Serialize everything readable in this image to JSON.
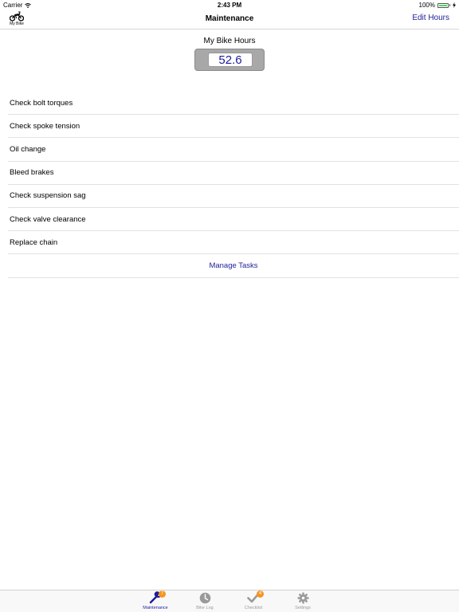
{
  "status_bar": {
    "carrier": "Carrier",
    "time": "2:43 PM",
    "battery": "100%",
    "battery_level": 1.0
  },
  "nav": {
    "left_label": "My Bike",
    "left_icon": "motorbike-icon",
    "title": "Maintenance",
    "right_button": "Edit Hours"
  },
  "hours": {
    "label": "My Bike Hours",
    "value": "52.6"
  },
  "tasks": [
    {
      "label": "Check bolt torques"
    },
    {
      "label": "Check spoke tension"
    },
    {
      "label": "Oil change"
    },
    {
      "label": "Bleed brakes"
    },
    {
      "label": "Check suspension sag"
    },
    {
      "label": "Check valve clearance"
    },
    {
      "label": "Replace chain"
    }
  ],
  "manage_tasks": "Manage Tasks",
  "tab_bar": {
    "tabs": [
      {
        "label": "Maintenance",
        "icon": "wrench-icon",
        "badge": "7",
        "active": true
      },
      {
        "label": "Bike Log",
        "icon": "clock-icon",
        "badge": "",
        "active": false
      },
      {
        "label": "Checklist",
        "icon": "checkmark-icon",
        "badge": "4",
        "active": false
      },
      {
        "label": "Settings",
        "icon": "gear-icon",
        "badge": "",
        "active": false
      }
    ]
  },
  "colors": {
    "accent": "#1d1d9a",
    "badge": "#f5951e",
    "battery": "#4cd964"
  }
}
